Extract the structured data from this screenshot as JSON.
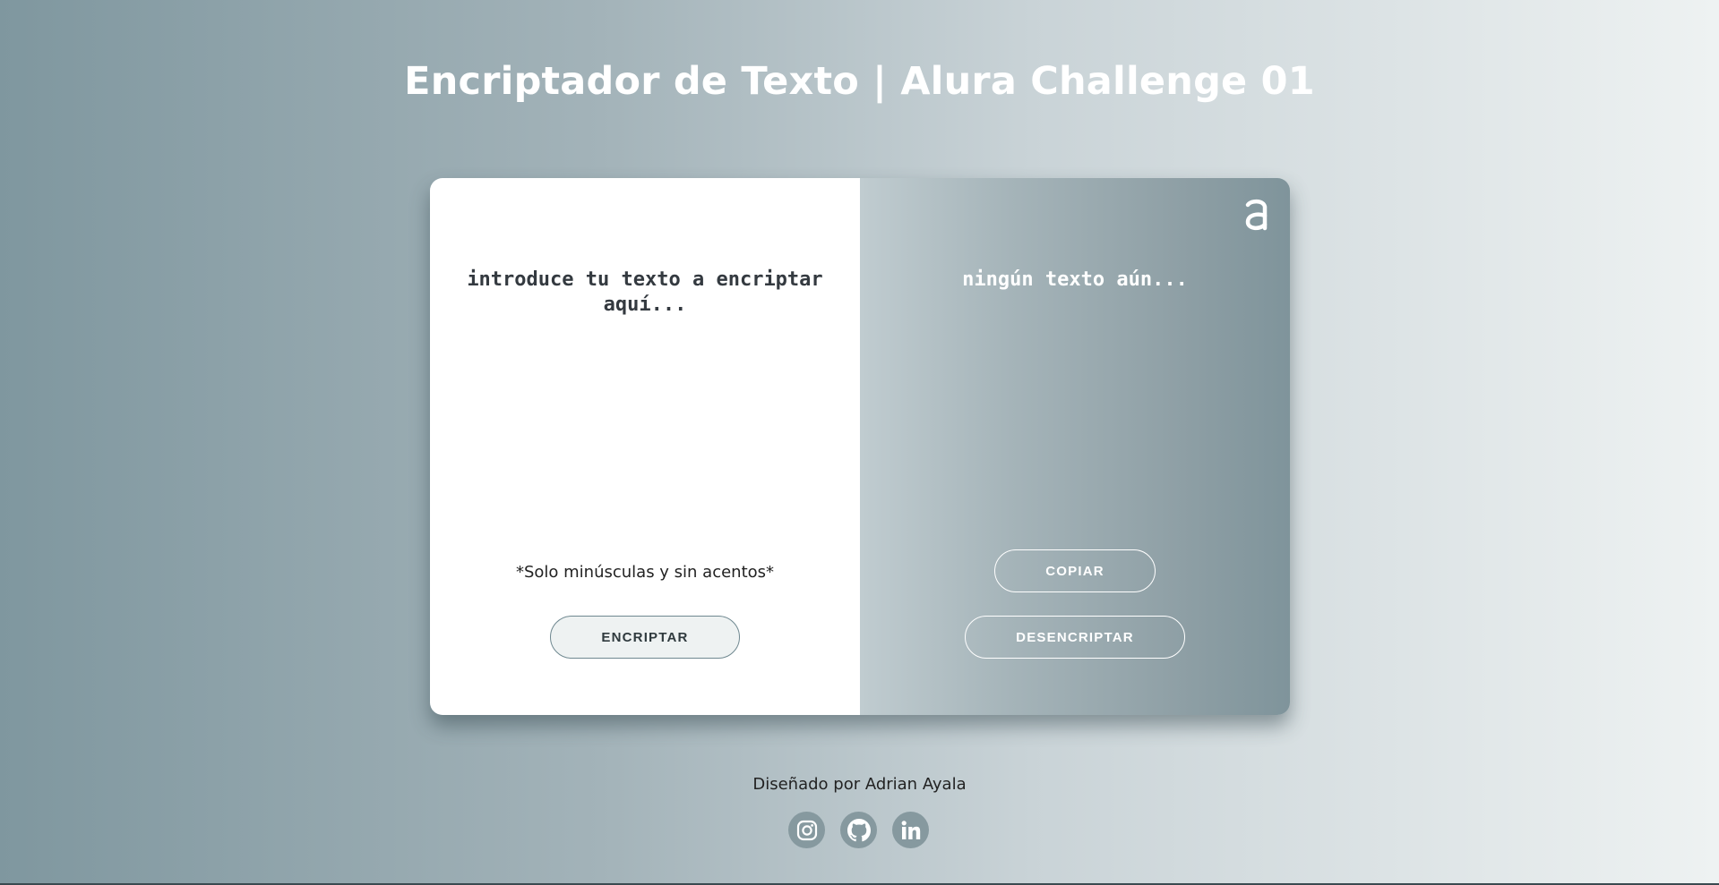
{
  "header": {
    "title": "Encriptador de Texto | Alura Challenge 01"
  },
  "input_panel": {
    "textarea_placeholder": "introduce tu texto a encriptar aquí...",
    "note": "*Solo minúsculas y sin acentos*",
    "encrypt_label": "ENCRIPTAR"
  },
  "output_panel": {
    "output_placeholder": "ningún texto aún...",
    "copy_label": "COPIAR",
    "decrypt_label": "DESENCRIPTAR",
    "logo_icon": "alura-logo-icon"
  },
  "footer": {
    "credit": "Diseñado por Adrian Ayala",
    "social": [
      {
        "icon": "instagram-icon"
      },
      {
        "icon": "github-icon"
      },
      {
        "icon": "linkedin-icon"
      }
    ]
  },
  "colors": {
    "card_left": "#ffffff",
    "encrypt_button_bg": "#eef2f2",
    "social_icon_bg": "#86999f",
    "title_text": "#ffffff"
  }
}
